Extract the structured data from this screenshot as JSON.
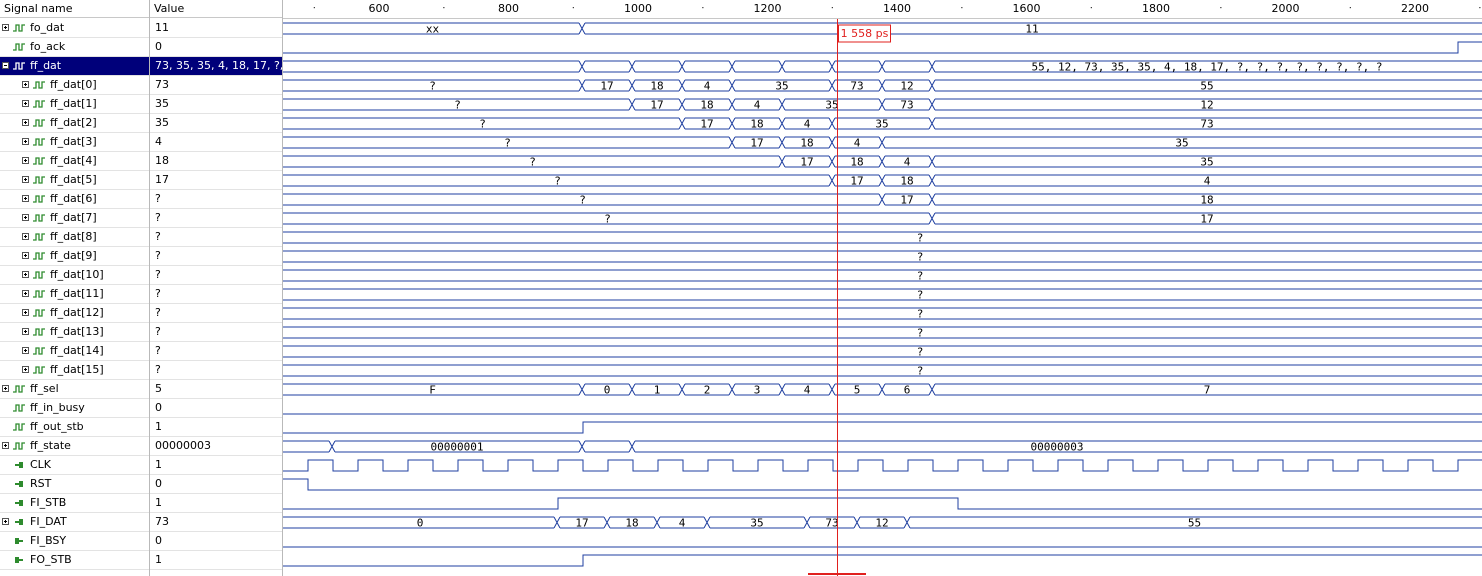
{
  "header": {
    "name_col": "Signal name",
    "value_col": "Value"
  },
  "timeline": {
    "ticks": [
      "600",
      "800",
      "1000",
      "1200",
      "1400",
      "1600",
      "1800",
      "2000",
      "2200"
    ]
  },
  "cursor": {
    "label": "1 558 ps",
    "color": "#e0201e"
  },
  "colors": {
    "wave": "#1f3fa0",
    "selected_row": "#00007a",
    "icon_green": "#2e8b2e"
  },
  "signals": [
    {
      "name": "fo_dat",
      "value": "11",
      "indent": 0,
      "expander": "plus",
      "icon": "signal"
    },
    {
      "name": "fo_ack",
      "value": "0",
      "indent": 0,
      "expander": "none",
      "icon": "signal"
    },
    {
      "name": "ff_dat",
      "value": "73, 35, 35, 4, 18, 17, ?, ?...",
      "indent": 0,
      "expander": "minus",
      "icon": "signal",
      "selected": true
    },
    {
      "name": "ff_dat[0]",
      "value": "73",
      "indent": 1,
      "expander": "plus",
      "icon": "signal"
    },
    {
      "name": "ff_dat[1]",
      "value": "35",
      "indent": 1,
      "expander": "plus",
      "icon": "signal"
    },
    {
      "name": "ff_dat[2]",
      "value": "35",
      "indent": 1,
      "expander": "plus",
      "icon": "signal"
    },
    {
      "name": "ff_dat[3]",
      "value": "4",
      "indent": 1,
      "expander": "plus",
      "icon": "signal"
    },
    {
      "name": "ff_dat[4]",
      "value": "18",
      "indent": 1,
      "expander": "plus",
      "icon": "signal"
    },
    {
      "name": "ff_dat[5]",
      "value": "17",
      "indent": 1,
      "expander": "plus",
      "icon": "signal"
    },
    {
      "name": "ff_dat[6]",
      "value": "?",
      "indent": 1,
      "expander": "plus",
      "icon": "signal"
    },
    {
      "name": "ff_dat[7]",
      "value": "?",
      "indent": 1,
      "expander": "plus",
      "icon": "signal"
    },
    {
      "name": "ff_dat[8]",
      "value": "?",
      "indent": 1,
      "expander": "plus",
      "icon": "signal"
    },
    {
      "name": "ff_dat[9]",
      "value": "?",
      "indent": 1,
      "expander": "plus",
      "icon": "signal"
    },
    {
      "name": "ff_dat[10]",
      "value": "?",
      "indent": 1,
      "expander": "plus",
      "icon": "signal"
    },
    {
      "name": "ff_dat[11]",
      "value": "?",
      "indent": 1,
      "expander": "plus",
      "icon": "signal"
    },
    {
      "name": "ff_dat[12]",
      "value": "?",
      "indent": 1,
      "expander": "plus",
      "icon": "signal"
    },
    {
      "name": "ff_dat[13]",
      "value": "?",
      "indent": 1,
      "expander": "plus",
      "icon": "signal"
    },
    {
      "name": "ff_dat[14]",
      "value": "?",
      "indent": 1,
      "expander": "plus",
      "icon": "signal"
    },
    {
      "name": "ff_dat[15]",
      "value": "?",
      "indent": 1,
      "expander": "plus",
      "icon": "signal"
    },
    {
      "name": "ff_sel",
      "value": "5",
      "indent": 0,
      "expander": "plus",
      "icon": "signal"
    },
    {
      "name": "ff_in_busy",
      "value": "0",
      "indent": 0,
      "expander": "none",
      "icon": "signal"
    },
    {
      "name": "ff_out_stb",
      "value": "1",
      "indent": 0,
      "expander": "none",
      "icon": "signal"
    },
    {
      "name": "ff_state",
      "value": "00000003",
      "indent": 0,
      "expander": "plus",
      "icon": "signal"
    },
    {
      "name": "CLK",
      "value": "1",
      "indent": 0,
      "expander": "none",
      "icon": "port-in"
    },
    {
      "name": "RST",
      "value": "0",
      "indent": 0,
      "expander": "none",
      "icon": "port-in"
    },
    {
      "name": "FI_STB",
      "value": "1",
      "indent": 0,
      "expander": "none",
      "icon": "port-in"
    },
    {
      "name": "FI_DAT",
      "value": "73",
      "indent": 0,
      "expander": "plus",
      "icon": "port-in"
    },
    {
      "name": "FI_BSY",
      "value": "0",
      "indent": 0,
      "expander": "none",
      "icon": "port-out"
    },
    {
      "name": "FO_STB",
      "value": "1",
      "indent": 0,
      "expander": "none",
      "icon": "port-out"
    }
  ],
  "waves": [
    {
      "type": "bus",
      "segs": [
        [
          0,
          582,
          "xx"
        ],
        [
          582,
          1482,
          "11"
        ]
      ]
    },
    {
      "type": "bit",
      "edges": [
        [
          0,
          0
        ],
        [
          1458,
          1
        ]
      ]
    },
    {
      "type": "bus",
      "segs": [
        [
          0,
          582,
          ""
        ],
        [
          582,
          632,
          ""
        ],
        [
          632,
          682,
          ""
        ],
        [
          682,
          732,
          ""
        ],
        [
          732,
          782,
          ""
        ],
        [
          782,
          832,
          ""
        ],
        [
          832,
          882,
          ""
        ],
        [
          882,
          932,
          ""
        ],
        [
          932,
          1482,
          "55, 12, 73, 35, 35, 4, 18, 17, ?, ?, ?, ?, ?, ?, ?, ?"
        ]
      ]
    },
    {
      "type": "bus",
      "segs": [
        [
          0,
          582,
          "?"
        ],
        [
          582,
          632,
          "17"
        ],
        [
          632,
          682,
          "18"
        ],
        [
          682,
          732,
          "4"
        ],
        [
          732,
          832,
          "35"
        ],
        [
          832,
          882,
          "73"
        ],
        [
          882,
          932,
          "12"
        ],
        [
          932,
          1482,
          "55"
        ]
      ]
    },
    {
      "type": "bus",
      "segs": [
        [
          0,
          632,
          "?"
        ],
        [
          632,
          682,
          "17"
        ],
        [
          682,
          732,
          "18"
        ],
        [
          732,
          782,
          "4"
        ],
        [
          782,
          882,
          "35"
        ],
        [
          882,
          932,
          "73"
        ],
        [
          932,
          1482,
          "12"
        ]
      ]
    },
    {
      "type": "bus",
      "segs": [
        [
          0,
          682,
          "?"
        ],
        [
          682,
          732,
          "17"
        ],
        [
          732,
          782,
          "18"
        ],
        [
          782,
          832,
          "4"
        ],
        [
          832,
          932,
          "35"
        ],
        [
          932,
          1482,
          "73"
        ]
      ]
    },
    {
      "type": "bus",
      "segs": [
        [
          0,
          732,
          "?"
        ],
        [
          732,
          782,
          "17"
        ],
        [
          782,
          832,
          "18"
        ],
        [
          832,
          882,
          "4"
        ],
        [
          882,
          1482,
          "35"
        ]
      ]
    },
    {
      "type": "bus",
      "segs": [
        [
          0,
          782,
          "?"
        ],
        [
          782,
          832,
          "17"
        ],
        [
          832,
          882,
          "18"
        ],
        [
          882,
          932,
          "4"
        ],
        [
          932,
          1482,
          "35"
        ]
      ]
    },
    {
      "type": "bus",
      "segs": [
        [
          0,
          832,
          "?"
        ],
        [
          832,
          882,
          "17"
        ],
        [
          882,
          932,
          "18"
        ],
        [
          932,
          1482,
          "4"
        ]
      ]
    },
    {
      "type": "bus",
      "segs": [
        [
          0,
          882,
          "?"
        ],
        [
          882,
          932,
          "17"
        ],
        [
          932,
          1482,
          "18"
        ]
      ]
    },
    {
      "type": "bus",
      "segs": [
        [
          0,
          932,
          "?"
        ],
        [
          932,
          1482,
          "17"
        ]
      ]
    },
    {
      "type": "bus",
      "segs": [
        [
          0,
          1482,
          "?"
        ]
      ],
      "labelx": 920
    },
    {
      "type": "bus",
      "segs": [
        [
          0,
          1482,
          "?"
        ]
      ],
      "labelx": 920
    },
    {
      "type": "bus",
      "segs": [
        [
          0,
          1482,
          "?"
        ]
      ],
      "labelx": 920
    },
    {
      "type": "bus",
      "segs": [
        [
          0,
          1482,
          "?"
        ]
      ],
      "labelx": 920
    },
    {
      "type": "bus",
      "segs": [
        [
          0,
          1482,
          "?"
        ]
      ],
      "labelx": 920
    },
    {
      "type": "bus",
      "segs": [
        [
          0,
          1482,
          "?"
        ]
      ],
      "labelx": 920
    },
    {
      "type": "bus",
      "segs": [
        [
          0,
          1482,
          "?"
        ]
      ],
      "labelx": 920
    },
    {
      "type": "bus",
      "segs": [
        [
          0,
          1482,
          "?"
        ]
      ],
      "labelx": 920
    },
    {
      "type": "bus",
      "segs": [
        [
          0,
          582,
          "F"
        ],
        [
          582,
          632,
          "0"
        ],
        [
          632,
          682,
          "1"
        ],
        [
          682,
          732,
          "2"
        ],
        [
          732,
          782,
          "3"
        ],
        [
          782,
          832,
          "4"
        ],
        [
          832,
          882,
          "5"
        ],
        [
          882,
          932,
          "6"
        ],
        [
          932,
          1482,
          "7"
        ]
      ]
    },
    {
      "type": "bit",
      "edges": [
        [
          0,
          0
        ]
      ]
    },
    {
      "type": "bit",
      "edges": [
        [
          0,
          0
        ],
        [
          583,
          1
        ]
      ]
    },
    {
      "type": "bus",
      "segs": [
        [
          0,
          332,
          ""
        ],
        [
          332,
          582,
          "00000001"
        ],
        [
          582,
          632,
          ""
        ],
        [
          632,
          1482,
          "00000003"
        ]
      ]
    },
    {
      "type": "clock",
      "start": 308,
      "period": 50,
      "high_first": true
    },
    {
      "type": "bit",
      "edges": [
        [
          0,
          1
        ],
        [
          308,
          0
        ]
      ]
    },
    {
      "type": "bit",
      "edges": [
        [
          0,
          0
        ],
        [
          558,
          1
        ],
        [
          958,
          0
        ]
      ]
    },
    {
      "type": "bus",
      "segs": [
        [
          0,
          557,
          "0"
        ],
        [
          557,
          607,
          "17"
        ],
        [
          607,
          657,
          "18"
        ],
        [
          657,
          707,
          "4"
        ],
        [
          707,
          807,
          "35"
        ],
        [
          807,
          857,
          "73"
        ],
        [
          857,
          907,
          "12"
        ],
        [
          907,
          1482,
          "55"
        ]
      ]
    },
    {
      "type": "bit",
      "edges": [
        [
          0,
          0
        ]
      ]
    },
    {
      "type": "bit",
      "edges": [
        [
          0,
          0
        ],
        [
          583,
          1
        ]
      ]
    }
  ]
}
